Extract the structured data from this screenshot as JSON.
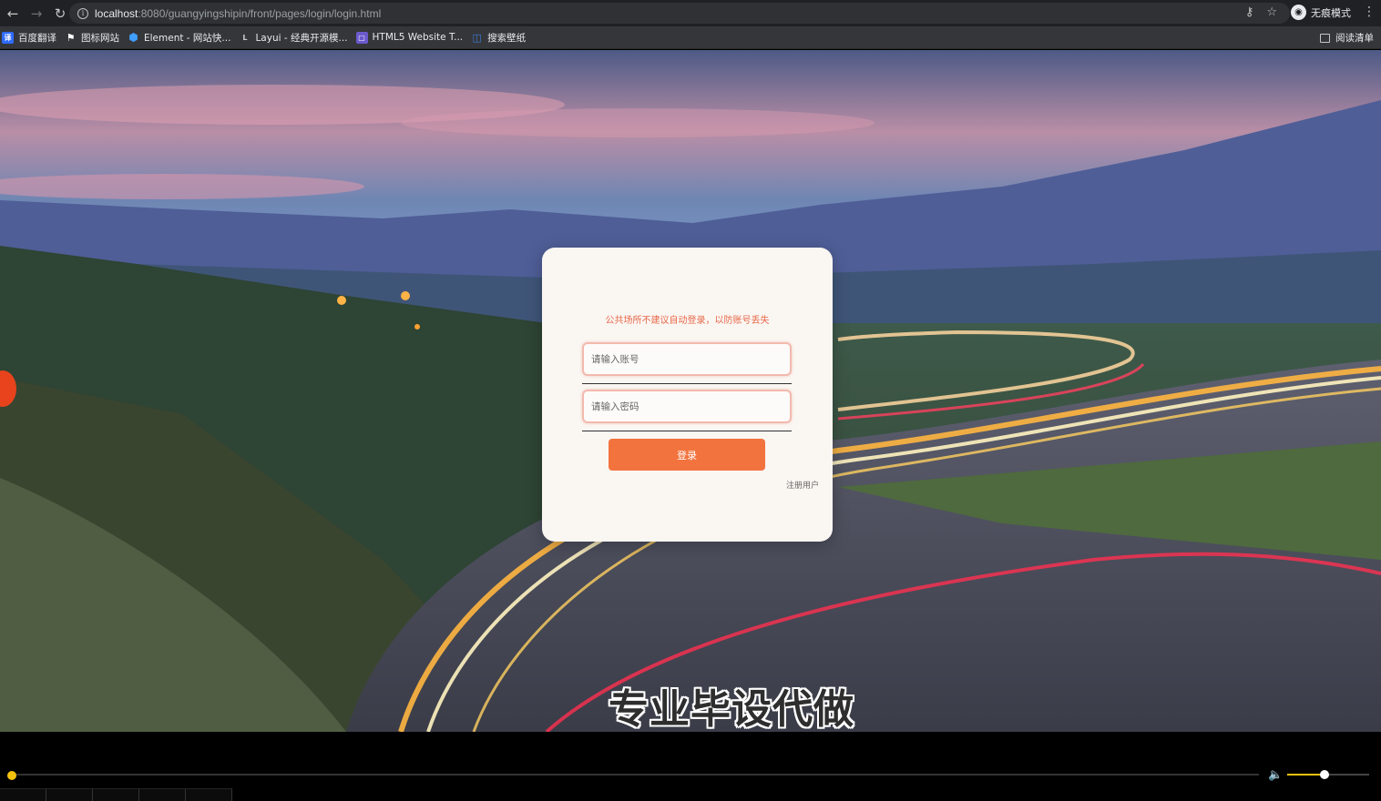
{
  "browser": {
    "url_host": "localhost",
    "url_path": ":8080/guangyingshipin/front/pages/login/login.html",
    "incognito_label": "无痕模式",
    "bookmarks": [
      {
        "label": "百度翻译",
        "icon": "baidu-translate-icon",
        "color": "#2f6bff"
      },
      {
        "label": "图标网站",
        "icon": "flag-icon",
        "color": "#ffffff"
      },
      {
        "label": "Element - 网站快...",
        "icon": "element-hex-icon",
        "color": "#409eff"
      },
      {
        "label": "Layui - 经典开源模...",
        "icon": "layui-icon",
        "color": "#cccccc"
      },
      {
        "label": "HTML5 Website T...",
        "icon": "html5-template-icon",
        "color": "#6a5acd"
      },
      {
        "label": "搜索壁纸",
        "icon": "wallpaper-search-icon",
        "color": "#3a7bd5"
      }
    ],
    "reading_list_label": "阅读清单"
  },
  "login": {
    "warning": "公共场所不建议自动登录，以防账号丢失",
    "username_placeholder": "请输入账号",
    "password_placeholder": "请输入密码",
    "submit_label": "登录",
    "register_label": "注册用户",
    "accent_color": "#f2733e"
  },
  "overlay": {
    "watermark": "专业毕设代做"
  },
  "player": {
    "progress": 0.0,
    "volume": 0.45
  }
}
